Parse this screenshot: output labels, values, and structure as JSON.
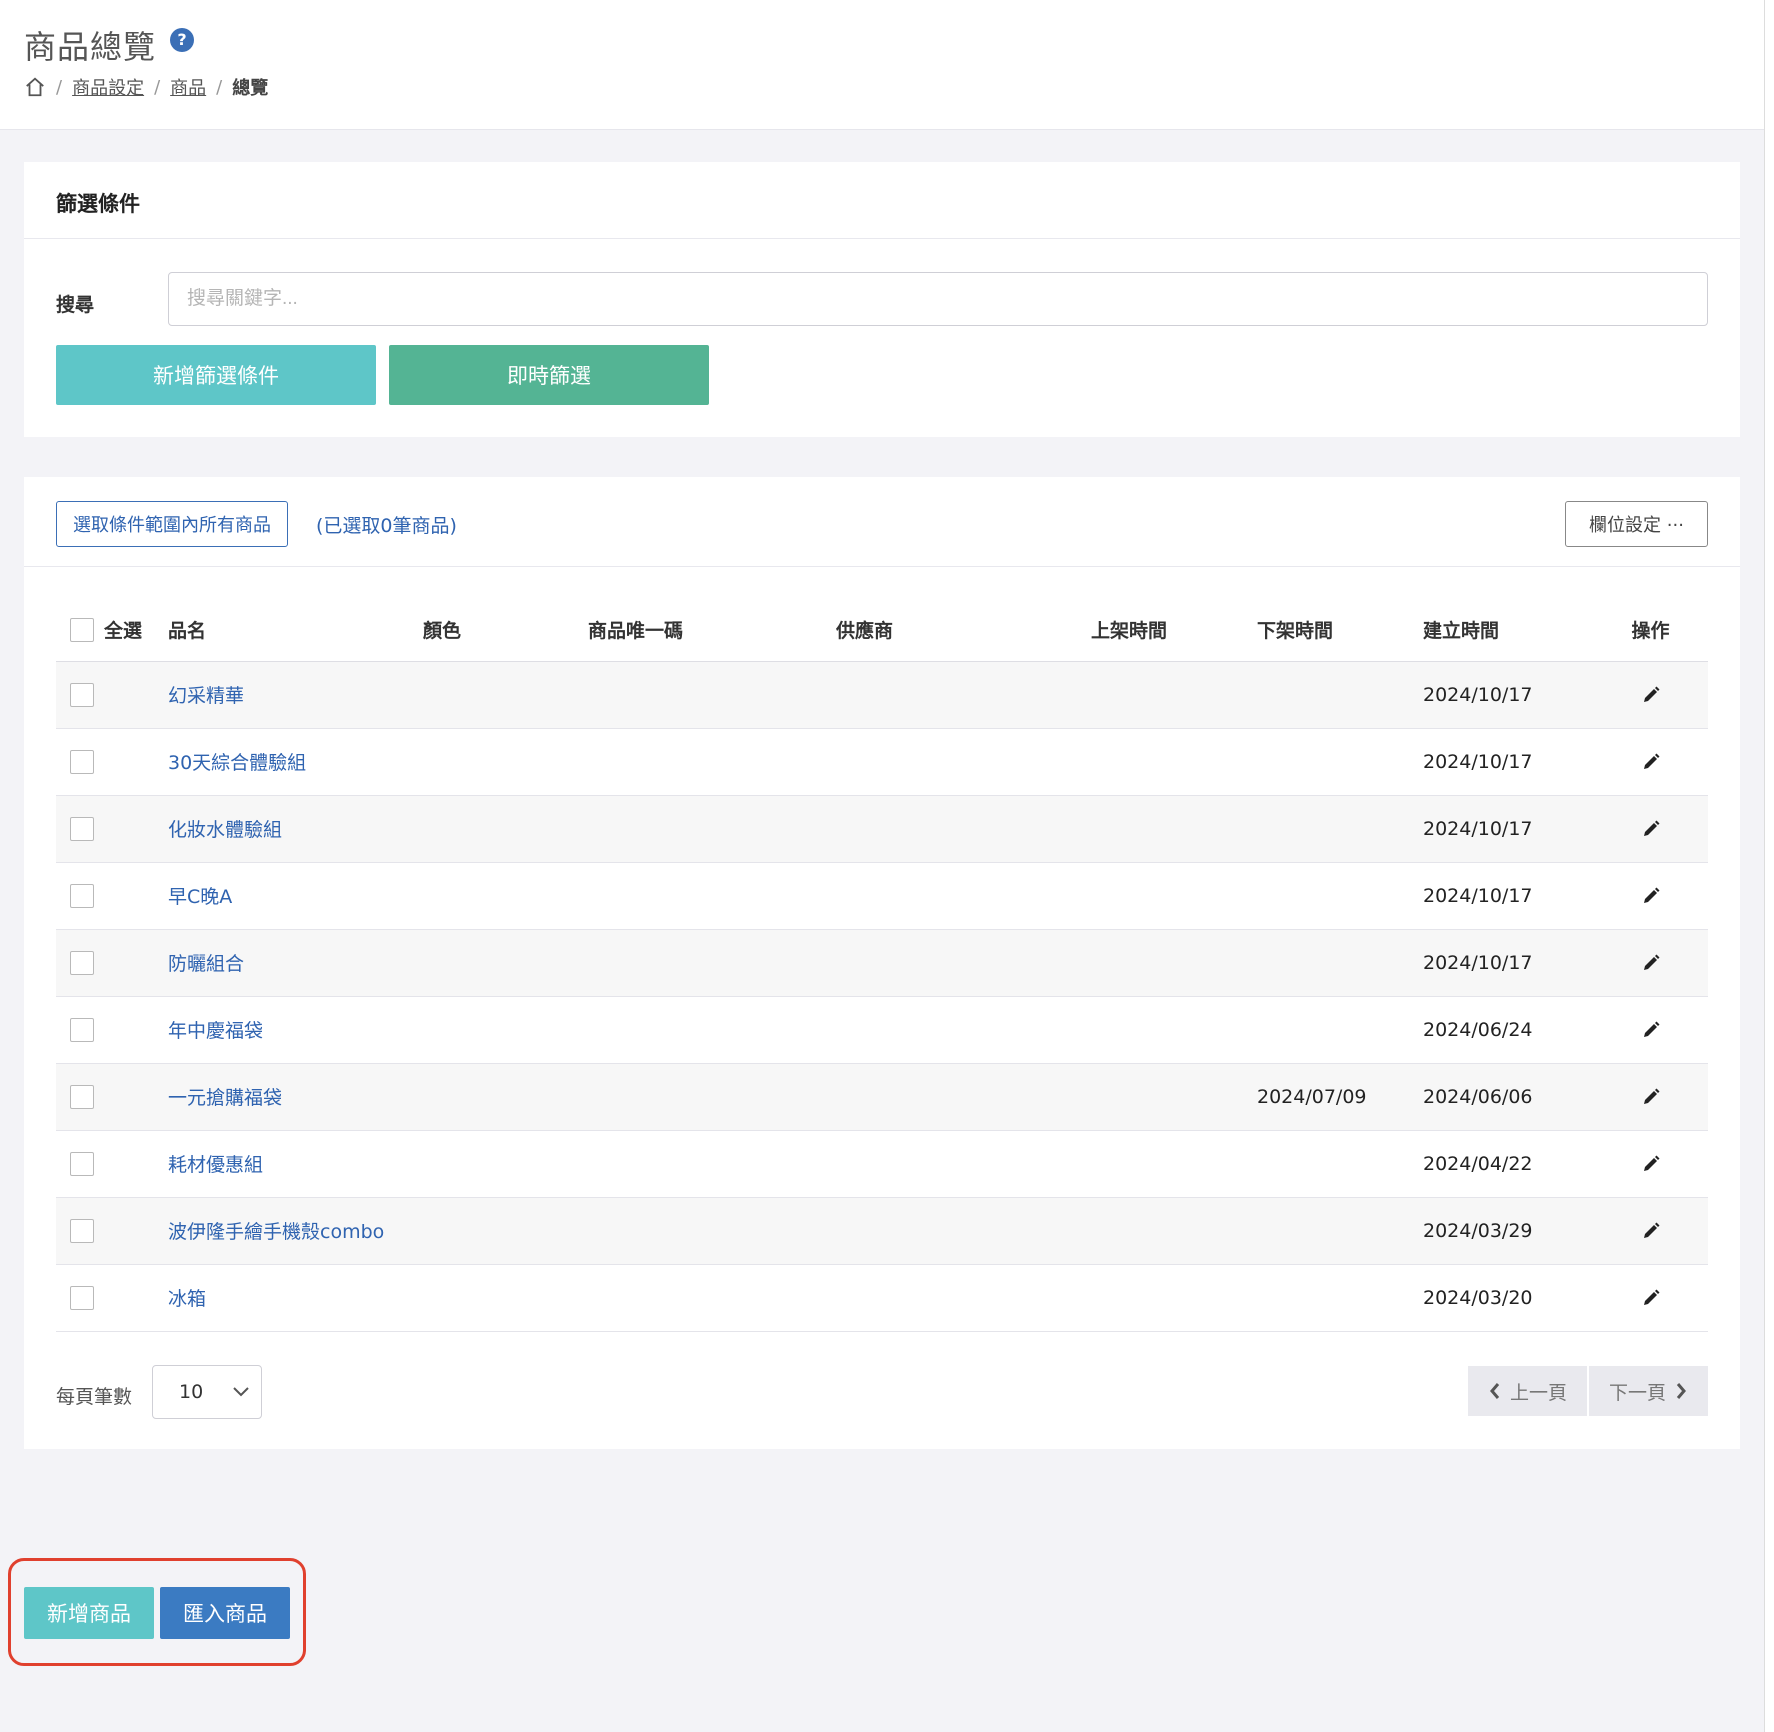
{
  "header": {
    "title": "商品總覽",
    "breadcrumb": [
      "商品設定",
      "商品",
      "總覽"
    ]
  },
  "filter": {
    "title": "篩選條件",
    "search_label": "搜尋",
    "search_placeholder": "搜尋關鍵字...",
    "search_value": "",
    "add_filter_label": "新增篩選條件",
    "instant_filter_label": "即時篩選"
  },
  "toolbar": {
    "select_all_range_label": "選取條件範圍內所有商品",
    "selected_count_text": "(已選取0筆商品)",
    "column_settings_label": "欄位設定 ···"
  },
  "table": {
    "columns": [
      "全選",
      "品名",
      "顏色",
      "商品唯一碼",
      "供應商",
      "上架時間",
      "下架時間",
      "建立時間",
      "操作"
    ],
    "rows": [
      {
        "name": "幻采精華",
        "color": "",
        "sku": "",
        "supplier": "",
        "on_shelf": "",
        "off_shelf": "",
        "created": "2024/10/17"
      },
      {
        "name": "30天綜合體驗組",
        "color": "",
        "sku": "",
        "supplier": "",
        "on_shelf": "",
        "off_shelf": "",
        "created": "2024/10/17"
      },
      {
        "name": "化妝水體驗組",
        "color": "",
        "sku": "",
        "supplier": "",
        "on_shelf": "",
        "off_shelf": "",
        "created": "2024/10/17"
      },
      {
        "name": "早C晚A",
        "color": "",
        "sku": "",
        "supplier": "",
        "on_shelf": "",
        "off_shelf": "",
        "created": "2024/10/17"
      },
      {
        "name": "防曬組合",
        "color": "",
        "sku": "",
        "supplier": "",
        "on_shelf": "",
        "off_shelf": "",
        "created": "2024/10/17"
      },
      {
        "name": "年中慶福袋",
        "color": "",
        "sku": "",
        "supplier": "",
        "on_shelf": "",
        "off_shelf": "",
        "created": "2024/06/24"
      },
      {
        "name": "一元搶購福袋",
        "color": "",
        "sku": "",
        "supplier": "",
        "on_shelf": "",
        "off_shelf": "2024/07/09",
        "created": "2024/06/06"
      },
      {
        "name": "耗材優惠組",
        "color": "",
        "sku": "",
        "supplier": "",
        "on_shelf": "",
        "off_shelf": "",
        "created": "2024/04/22"
      },
      {
        "name": "波伊隆手繪手機殼combo",
        "color": "",
        "sku": "",
        "supplier": "",
        "on_shelf": "",
        "off_shelf": "",
        "created": "2024/03/29"
      },
      {
        "name": "冰箱",
        "color": "",
        "sku": "",
        "supplier": "",
        "on_shelf": "",
        "off_shelf": "",
        "created": "2024/03/20"
      }
    ]
  },
  "pagination": {
    "per_page_label": "每頁筆數",
    "per_page_value": "10",
    "prev_label": "上一頁",
    "next_label": "下一頁"
  },
  "actions": {
    "add_product_label": "新增商品",
    "import_product_label": "匯入商品"
  },
  "colors": {
    "primary_blue": "#3b6fb6",
    "teal": "#5ec6c8",
    "green": "#54b494",
    "highlight_red": "#e0402e"
  },
  "icons": {
    "help": "question-circle-icon",
    "home": "home-icon",
    "edit": "pencil-icon",
    "prev": "chevron-left-icon",
    "next": "chevron-right-icon",
    "select": "chevron-down-icon"
  }
}
